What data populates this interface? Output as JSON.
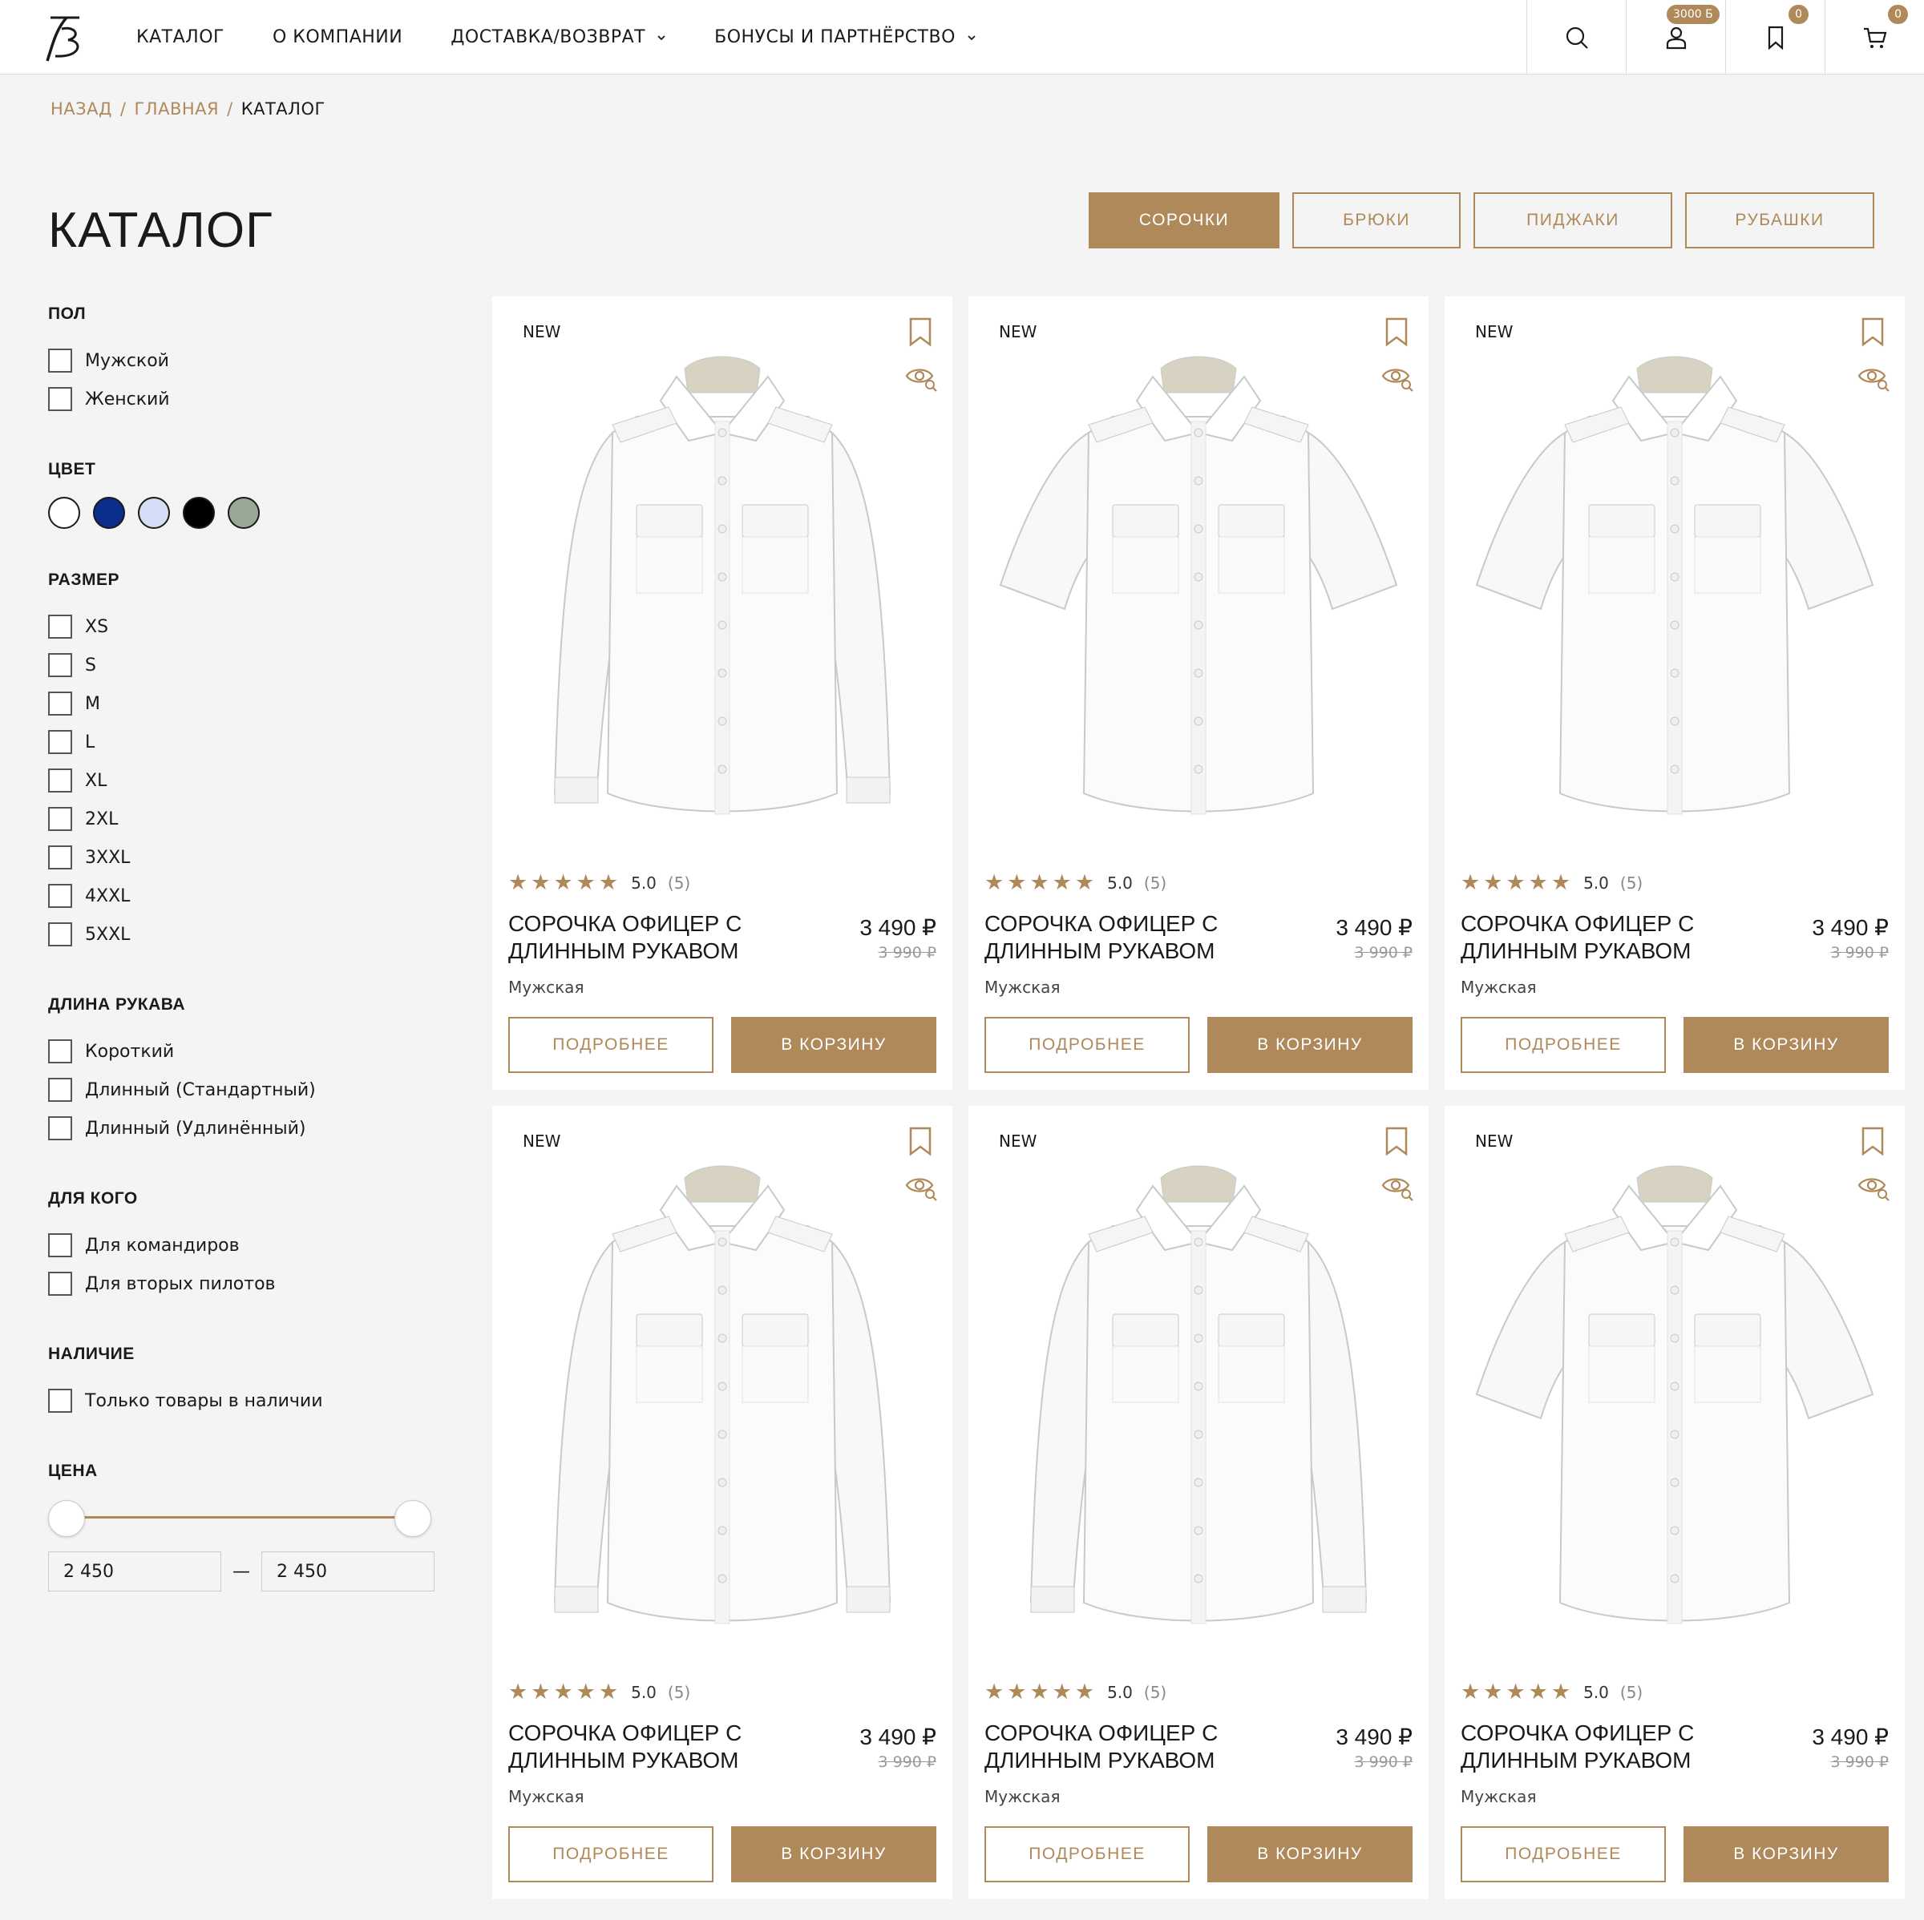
{
  "header": {
    "nav": [
      {
        "label": "Каталог",
        "dropdown": false
      },
      {
        "label": "О компании",
        "dropdown": false
      },
      {
        "label": "Доставка/возврат",
        "dropdown": true
      },
      {
        "label": "Бонусы и партнёрство",
        "dropdown": true
      }
    ],
    "icons": {
      "search": "search-icon",
      "account": "user-icon",
      "favorites": "bookmark-icon",
      "cart": "cart-icon"
    },
    "badges": {
      "account": "3000 Б",
      "favorites": "0",
      "cart": "0"
    }
  },
  "breadcrumb": {
    "back": "Назад",
    "home": "Главная",
    "current": "Каталог",
    "separator": "/"
  },
  "page_title": "Каталог",
  "category_tabs": [
    {
      "label": "Сорочки",
      "active": true
    },
    {
      "label": "Брюки",
      "active": false
    },
    {
      "label": "Пиджаки",
      "active": false
    },
    {
      "label": "Рубашки",
      "active": false
    }
  ],
  "filters": {
    "gender": {
      "title": "Пол",
      "options": [
        "Мужской",
        "Женский"
      ]
    },
    "color": {
      "title": "Цвет",
      "swatches": [
        "#ffffff",
        "#0a2e8c",
        "#d3ddf3",
        "#000000",
        "#98a895"
      ]
    },
    "size": {
      "title": "Размер",
      "options": [
        "XS",
        "S",
        "M",
        "L",
        "XL",
        "2XL",
        "3XXL",
        "4XXL",
        "5XXL"
      ]
    },
    "sleeve": {
      "title": "Длина рукава",
      "options": [
        "Короткий",
        "Длинный (Стандартный)",
        "Длинный (Удлинённый)"
      ]
    },
    "for_whom": {
      "title": "Для кого",
      "options": [
        "Для командиров",
        "Для вторых пилотов"
      ]
    },
    "availability": {
      "title": "Наличие",
      "options": [
        "Только товары в наличии"
      ]
    },
    "price": {
      "title": "Цена",
      "min": "2 450",
      "max": "2 450",
      "dash": "—"
    }
  },
  "products": [
    {
      "badge": "NEW",
      "rating": "5.0",
      "reviews": "(5)",
      "name": "Сорочка офицер с длинным рукавом",
      "price": "3 490 ₽",
      "old_price": "3 990 ₽",
      "gender": "Мужская",
      "more_label": "Подробнее",
      "cart_label": "В корзину",
      "sleeve": "long"
    },
    {
      "badge": "NEW",
      "rating": "5.0",
      "reviews": "(5)",
      "name": "Сорочка офицер с длинным рукавом",
      "price": "3 490 ₽",
      "old_price": "3 990 ₽",
      "gender": "Мужская",
      "more_label": "Подробнее",
      "cart_label": "В корзину",
      "sleeve": "short"
    },
    {
      "badge": "NEW",
      "rating": "5.0",
      "reviews": "(5)",
      "name": "Сорочка офицер с длинным рукавом",
      "price": "3 490 ₽",
      "old_price": "3 990 ₽",
      "gender": "Мужская",
      "more_label": "Подробнее",
      "cart_label": "В корзину",
      "sleeve": "short"
    },
    {
      "badge": "NEW",
      "rating": "5.0",
      "reviews": "(5)",
      "name": "Сорочка офицер с длинным рукавом",
      "price": "3 490 ₽",
      "old_price": "3 990 ₽",
      "gender": "Мужская",
      "more_label": "Подробнее",
      "cart_label": "В корзину",
      "sleeve": "long"
    },
    {
      "badge": "NEW",
      "rating": "5.0",
      "reviews": "(5)",
      "name": "Сорочка офицер с длинным рукавом",
      "price": "3 490 ₽",
      "old_price": "3 990 ₽",
      "gender": "Мужская",
      "more_label": "Подробнее",
      "cart_label": "В корзину",
      "sleeve": "long"
    },
    {
      "badge": "NEW",
      "rating": "5.0",
      "reviews": "(5)",
      "name": "Сорочка офицер с длинным рукавом",
      "price": "3 490 ₽",
      "old_price": "3 990 ₽",
      "gender": "Мужская",
      "more_label": "Подробнее",
      "cart_label": "В корзину",
      "sleeve": "short"
    }
  ],
  "colors": {
    "accent": "#b0895a",
    "text": "#1a1a1a",
    "background": "#f4f4f4"
  }
}
